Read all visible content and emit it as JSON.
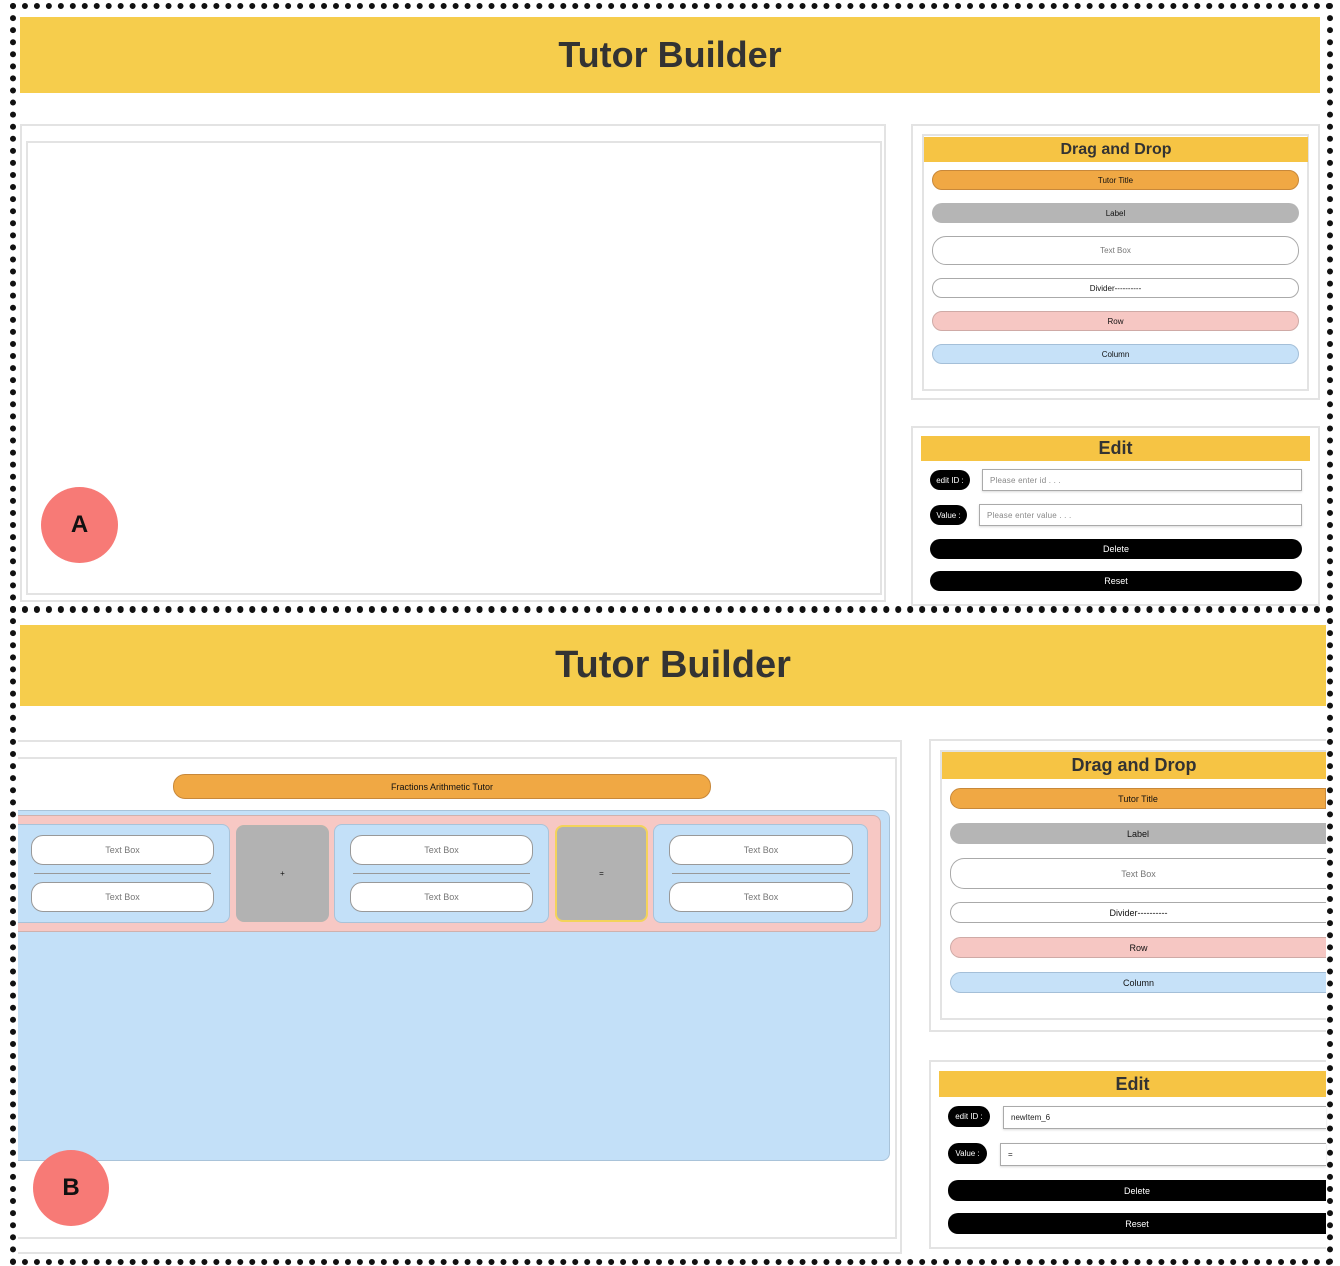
{
  "colors": {
    "header": "#f6cd4c",
    "section_title": "#f6c444",
    "title_pill": "#f0a844",
    "label_pill": "#b5b5b5",
    "row_pill": "#f6c7c3",
    "column_pill": "#c6e1f8",
    "badge": "#f77a76"
  },
  "panel_a": {
    "app_title": "Tutor Builder",
    "badge": "A",
    "palette": {
      "title": "Drag and Drop",
      "items": [
        "Tutor Title",
        "Label",
        "Text Box",
        "Divider----------",
        "Row",
        "Column"
      ]
    },
    "edit": {
      "title": "Edit",
      "id_label": "edit ID :",
      "id_placeholder": "Please enter id . . .",
      "value_label": "Value :",
      "value_placeholder": "Please enter value . . .",
      "delete_label": "Delete",
      "reset_label": "Reset"
    }
  },
  "panel_b": {
    "app_title": "Tutor Builder",
    "badge": "B",
    "canvas": {
      "tutor_title": "Fractions Arithmetic Tutor",
      "fractions": [
        {
          "top": "Text Box",
          "bottom": "Text Box"
        },
        {
          "top": "Text Box",
          "bottom": "Text Box"
        },
        {
          "top": "Text Box",
          "bottom": "Text Box"
        }
      ],
      "operators": [
        "+",
        "="
      ]
    },
    "palette": {
      "title": "Drag and Drop",
      "items": [
        "Tutor Title",
        "Label",
        "Text Box",
        "Divider----------",
        "Row",
        "Column"
      ]
    },
    "edit": {
      "title": "Edit",
      "id_label": "edit ID :",
      "id_value": "newItem_6",
      "value_label": "Value :",
      "value_value": "=",
      "delete_label": "Delete",
      "reset_label": "Reset"
    }
  }
}
